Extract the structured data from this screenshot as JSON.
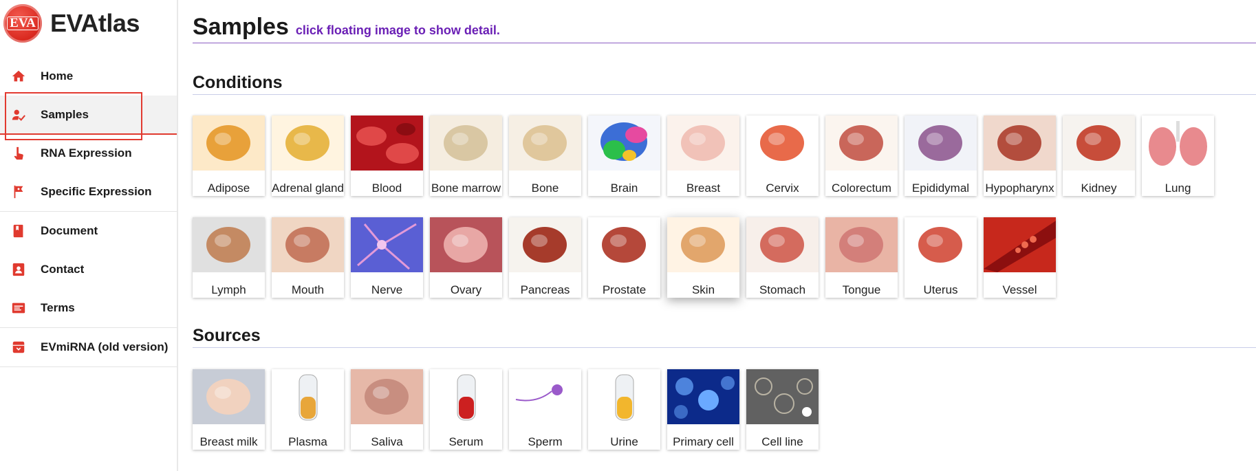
{
  "app": {
    "logo_text": "EVA",
    "title": "EVAtlas"
  },
  "sidebar": {
    "items": [
      {
        "label": "Home",
        "icon": "home-icon"
      },
      {
        "label": "Samples",
        "icon": "samples-icon",
        "active": true
      },
      {
        "label": "RNA Expression",
        "icon": "rna-expression-icon"
      },
      {
        "label": "Specific Expression",
        "icon": "flag-icon"
      },
      {
        "label": "Document",
        "icon": "book-icon"
      },
      {
        "label": "Contact",
        "icon": "contact-icon"
      },
      {
        "label": "Terms",
        "icon": "terms-icon"
      },
      {
        "label": "EVmiRNA (old version)",
        "icon": "archive-icon"
      }
    ]
  },
  "page": {
    "title": "Samples",
    "hint": "click floating image to show detail."
  },
  "sections": {
    "conditions": {
      "title": "Conditions",
      "items": [
        "Adipose",
        "Adrenal gland",
        "Blood",
        "Bone marrow",
        "Bone",
        "Brain",
        "Breast",
        "Cervix",
        "Colorectum",
        "Epididymal",
        "Hypopharynx",
        "Kidney",
        "Lung",
        "Lymph",
        "Mouth",
        "Nerve",
        "Ovary",
        "Pancreas",
        "Prostate",
        "Skin",
        "Stomach",
        "Tongue",
        "Uterus",
        "Vessel"
      ]
    },
    "sources": {
      "title": "Sources",
      "items": [
        "Breast milk",
        "Plasma",
        "Saliva",
        "Serum",
        "Sperm",
        "Urine",
        "Primary cell",
        "Cell line"
      ]
    }
  },
  "colors": {
    "accent": "#e03a2f",
    "hint": "#6a1fb5",
    "section_line": "#c8cde8"
  }
}
